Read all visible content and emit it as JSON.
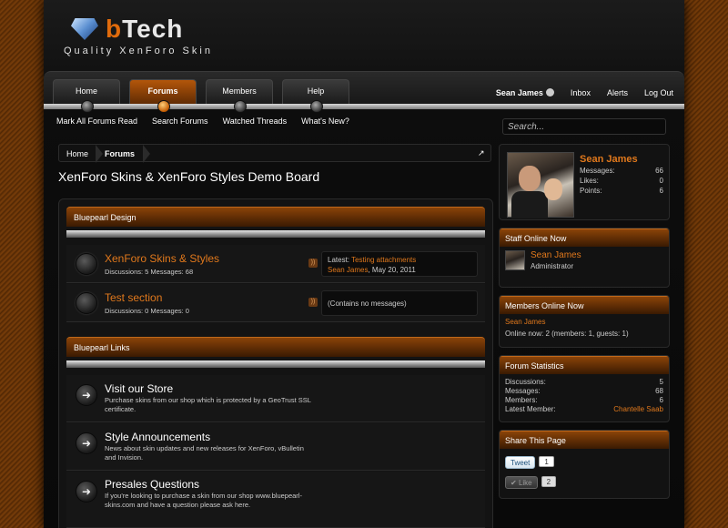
{
  "logo": {
    "brand_b": "b",
    "brand_rest": "Tech",
    "tagline": "Quality XenForo Skin",
    "icon": "diamond-icon"
  },
  "nav": {
    "tabs": [
      {
        "label": "Home",
        "active": false
      },
      {
        "label": "Forums",
        "active": true
      },
      {
        "label": "Members",
        "active": false
      },
      {
        "label": "Help",
        "active": false
      }
    ],
    "user": {
      "name": "Sean James",
      "inbox": "Inbox",
      "alerts": "Alerts",
      "logout": "Log Out"
    },
    "subnav": [
      "Mark All Forums Read",
      "Search Forums",
      "Watched Threads",
      "What's New?"
    ]
  },
  "search": {
    "placeholder": "Search..."
  },
  "breadcrumb": {
    "home": "Home",
    "current": "Forums"
  },
  "page_title": "XenForo Skins & XenForo Styles Demo Board",
  "categories": [
    {
      "title": "Bluepearl Design",
      "forums": [
        {
          "title": "XenForo Skins & Styles",
          "stats": "Discussions: 5 Messages: 68",
          "latest_prefix": "Latest:",
          "latest_thread": "Testing attachments",
          "latest_user": "Sean James",
          "latest_date": ", May 20, 2011"
        },
        {
          "title": "Test section",
          "stats": "Discussions: 0 Messages: 0",
          "empty": "(Contains no messages)"
        }
      ]
    },
    {
      "title": "Bluepearl Links",
      "links": [
        {
          "title": "Visit our Store",
          "desc": "Purchase skins from our shop which is protected by a GeoTrust SSL certificate."
        },
        {
          "title": "Style Announcements",
          "desc": "News about skin updates and new releases for XenForo, vBulletin and Invision."
        },
        {
          "title": "Presales Questions",
          "desc": "If you're looking to purchase a skin from our shop www.bluepearl-skins.com and have a question please ask here."
        }
      ]
    }
  ],
  "profile": {
    "name": "Sean James",
    "messages_label": "Messages:",
    "messages": "66",
    "likes_label": "Likes:",
    "likes": "0",
    "points_label": "Points:",
    "points": "6"
  },
  "staff_online": {
    "title": "Staff Online Now",
    "name": "Sean James",
    "role": "Administrator"
  },
  "members_online": {
    "title": "Members Online Now",
    "name": "Sean James",
    "summary": "Online now: 2 (members: 1, guests: 1)"
  },
  "stats": {
    "title": "Forum Statistics",
    "discussions_label": "Discussions:",
    "discussions": "5",
    "messages_label": "Messages:",
    "messages": "68",
    "members_label": "Members:",
    "members": "6",
    "latest_label": "Latest Member:",
    "latest": "Chantelle Saab"
  },
  "share": {
    "title": "Share This Page",
    "tweet": "Tweet",
    "tweet_count": "1",
    "like": "Like",
    "like_count": "2"
  },
  "colors": {
    "accent": "#e0781c",
    "header_brown": "#8a4308"
  }
}
